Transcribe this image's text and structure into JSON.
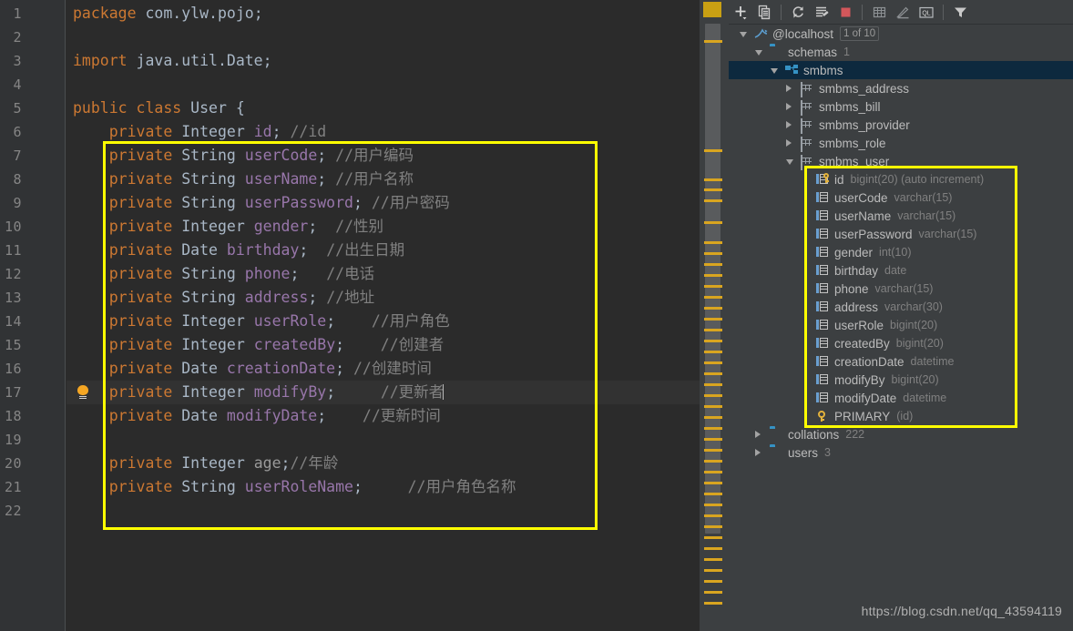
{
  "editor": {
    "line_numbers": [
      "1",
      "2",
      "3",
      "4",
      "5",
      "6",
      "7",
      "8",
      "9",
      "10",
      "11",
      "12",
      "13",
      "14",
      "15",
      "16",
      "17",
      "18",
      "19",
      "20",
      "21",
      "22"
    ],
    "current_line": "17",
    "intention_bulb_icon": "lightbulb-icon",
    "lines": [
      {
        "n": "1",
        "segments": [
          {
            "t": "package ",
            "c": "kw"
          },
          {
            "t": "com.ylw.pojo;",
            "c": "pkg"
          }
        ]
      },
      {
        "n": "2",
        "segments": []
      },
      {
        "n": "3",
        "segments": [
          {
            "t": "import ",
            "c": "kw"
          },
          {
            "t": "java.util.Date;",
            "c": "pkg"
          }
        ]
      },
      {
        "n": "4",
        "segments": []
      },
      {
        "n": "5",
        "segments": [
          {
            "t": "public class ",
            "c": "kw"
          },
          {
            "t": "User",
            "c": "cname"
          },
          {
            "t": " {",
            "c": "pun"
          }
        ]
      },
      {
        "n": "6",
        "segments": [
          {
            "t": "    ",
            "c": "pun"
          },
          {
            "t": "private ",
            "c": "kw"
          },
          {
            "t": "Integer ",
            "c": "typ"
          },
          {
            "t": "id",
            "c": "fld"
          },
          {
            "t": "; ",
            "c": "pun"
          },
          {
            "t": "//id",
            "c": "cmt"
          }
        ]
      },
      {
        "n": "7",
        "segments": [
          {
            "t": "    ",
            "c": "pun"
          },
          {
            "t": "private ",
            "c": "kw"
          },
          {
            "t": "String ",
            "c": "typ"
          },
          {
            "t": "userCode",
            "c": "fld"
          },
          {
            "t": "; ",
            "c": "pun"
          },
          {
            "t": "//用户编码",
            "c": "cmt"
          }
        ]
      },
      {
        "n": "8",
        "segments": [
          {
            "t": "    ",
            "c": "pun"
          },
          {
            "t": "private ",
            "c": "kw"
          },
          {
            "t": "String ",
            "c": "typ"
          },
          {
            "t": "userName",
            "c": "fld"
          },
          {
            "t": "; ",
            "c": "pun"
          },
          {
            "t": "//用户名称",
            "c": "cmt"
          }
        ]
      },
      {
        "n": "9",
        "segments": [
          {
            "t": "    ",
            "c": "pun"
          },
          {
            "t": "private ",
            "c": "kw"
          },
          {
            "t": "String ",
            "c": "typ"
          },
          {
            "t": "userPassword",
            "c": "fld"
          },
          {
            "t": "; ",
            "c": "pun"
          },
          {
            "t": "//用户密码",
            "c": "cmt"
          }
        ]
      },
      {
        "n": "10",
        "segments": [
          {
            "t": "    ",
            "c": "pun"
          },
          {
            "t": "private ",
            "c": "kw"
          },
          {
            "t": "Integer ",
            "c": "typ"
          },
          {
            "t": "gender",
            "c": "fld"
          },
          {
            "t": ";  ",
            "c": "pun"
          },
          {
            "t": "//性别",
            "c": "cmt"
          }
        ]
      },
      {
        "n": "11",
        "segments": [
          {
            "t": "    ",
            "c": "pun"
          },
          {
            "t": "private ",
            "c": "kw"
          },
          {
            "t": "Date ",
            "c": "typ"
          },
          {
            "t": "birthday",
            "c": "fld"
          },
          {
            "t": ";  ",
            "c": "pun"
          },
          {
            "t": "//出生日期",
            "c": "cmt"
          }
        ]
      },
      {
        "n": "12",
        "segments": [
          {
            "t": "    ",
            "c": "pun"
          },
          {
            "t": "private ",
            "c": "kw"
          },
          {
            "t": "String ",
            "c": "typ"
          },
          {
            "t": "phone",
            "c": "fld"
          },
          {
            "t": ";   ",
            "c": "pun"
          },
          {
            "t": "//电话",
            "c": "cmt"
          }
        ]
      },
      {
        "n": "13",
        "segments": [
          {
            "t": "    ",
            "c": "pun"
          },
          {
            "t": "private ",
            "c": "kw"
          },
          {
            "t": "String ",
            "c": "typ"
          },
          {
            "t": "address",
            "c": "fld"
          },
          {
            "t": "; ",
            "c": "pun"
          },
          {
            "t": "//地址",
            "c": "cmt"
          }
        ]
      },
      {
        "n": "14",
        "segments": [
          {
            "t": "    ",
            "c": "pun"
          },
          {
            "t": "private ",
            "c": "kw"
          },
          {
            "t": "Integer ",
            "c": "typ"
          },
          {
            "t": "userRole",
            "c": "fld"
          },
          {
            "t": ";    ",
            "c": "pun"
          },
          {
            "t": "//用户角色",
            "c": "cmt"
          }
        ]
      },
      {
        "n": "15",
        "segments": [
          {
            "t": "    ",
            "c": "pun"
          },
          {
            "t": "private ",
            "c": "kw"
          },
          {
            "t": "Integer ",
            "c": "typ"
          },
          {
            "t": "createdBy",
            "c": "fld"
          },
          {
            "t": ";    ",
            "c": "pun"
          },
          {
            "t": "//创建者",
            "c": "cmt"
          }
        ]
      },
      {
        "n": "16",
        "segments": [
          {
            "t": "    ",
            "c": "pun"
          },
          {
            "t": "private ",
            "c": "kw"
          },
          {
            "t": "Date ",
            "c": "typ"
          },
          {
            "t": "creationDate",
            "c": "fld"
          },
          {
            "t": "; ",
            "c": "pun"
          },
          {
            "t": "//创建时间",
            "c": "cmt"
          }
        ]
      },
      {
        "n": "17",
        "segments": [
          {
            "t": "    ",
            "c": "pun"
          },
          {
            "t": "private ",
            "c": "kw"
          },
          {
            "t": "Integer ",
            "c": "typ"
          },
          {
            "t": "modifyBy",
            "c": "fld"
          },
          {
            "t": ";     ",
            "c": "pun"
          },
          {
            "t": "//更新者",
            "c": "cmt"
          }
        ],
        "caret": true
      },
      {
        "n": "18",
        "segments": [
          {
            "t": "    ",
            "c": "pun"
          },
          {
            "t": "private ",
            "c": "kw"
          },
          {
            "t": "Date ",
            "c": "typ"
          },
          {
            "t": "modifyDate",
            "c": "fld"
          },
          {
            "t": ";    ",
            "c": "pun"
          },
          {
            "t": "//更新时间",
            "c": "cmt"
          }
        ]
      },
      {
        "n": "19",
        "segments": []
      },
      {
        "n": "20",
        "segments": [
          {
            "t": "    ",
            "c": "pun"
          },
          {
            "t": "private ",
            "c": "kw"
          },
          {
            "t": "Integer ",
            "c": "typ"
          },
          {
            "t": "age",
            "c": "fldg"
          },
          {
            "t": ";",
            "c": "pun"
          },
          {
            "t": "//年龄",
            "c": "cmt"
          }
        ]
      },
      {
        "n": "21",
        "segments": [
          {
            "t": "    ",
            "c": "pun"
          },
          {
            "t": "private ",
            "c": "kw"
          },
          {
            "t": "String ",
            "c": "typ"
          },
          {
            "t": "userRoleName",
            "c": "fld"
          },
          {
            "t": ";     ",
            "c": "pun"
          },
          {
            "t": "//用户角色名称",
            "c": "cmt"
          }
        ]
      },
      {
        "n": "22",
        "segments": []
      }
    ]
  },
  "annotations": {
    "code_box_color": "#ffff00",
    "tree_box_color": "#ffff00"
  },
  "scrollbar": {
    "warning_marker_color": "#d9a520",
    "top_marker_color": "#c9a013",
    "thumb_color": "#595b5d"
  },
  "db_panel": {
    "toolbar": [
      {
        "name": "add-icon",
        "label": "+"
      },
      {
        "name": "duplicate-icon",
        "label": "duplicate"
      },
      {
        "name": "refresh-icon",
        "label": "refresh"
      },
      {
        "name": "sql-script-icon",
        "label": "jump-to-query"
      },
      {
        "name": "stop-icon",
        "label": "stop"
      },
      {
        "name": "data-table-icon",
        "label": "open-data-editor"
      },
      {
        "name": "edit-icon",
        "label": "modify"
      },
      {
        "name": "query-console-icon",
        "label": "QL"
      },
      {
        "name": "filter-icon",
        "label": "filter"
      }
    ],
    "tree": [
      {
        "indent": 0,
        "twisty": "down",
        "icon": "mysql-connection-icon",
        "label": "@localhost",
        "badge": "1 of 10",
        "meta": "",
        "selected": false
      },
      {
        "indent": 1,
        "twisty": "down",
        "icon": "folder-icon",
        "label": "schemas",
        "badge": "",
        "meta": "1",
        "selected": false
      },
      {
        "indent": 2,
        "twisty": "down",
        "icon": "schema-icon",
        "label": "smbms",
        "badge": "",
        "meta": "",
        "selected": true
      },
      {
        "indent": 3,
        "twisty": "right",
        "icon": "table-icon",
        "label": "smbms_address",
        "badge": "",
        "meta": "",
        "selected": false
      },
      {
        "indent": 3,
        "twisty": "right",
        "icon": "table-icon",
        "label": "smbms_bill",
        "badge": "",
        "meta": "",
        "selected": false
      },
      {
        "indent": 3,
        "twisty": "right",
        "icon": "table-icon",
        "label": "smbms_provider",
        "badge": "",
        "meta": "",
        "selected": false
      },
      {
        "indent": 3,
        "twisty": "right",
        "icon": "table-icon",
        "label": "smbms_role",
        "badge": "",
        "meta": "",
        "selected": false
      },
      {
        "indent": 3,
        "twisty": "down",
        "icon": "table-icon",
        "label": "smbms_user",
        "badge": "",
        "meta": "",
        "selected": false
      },
      {
        "indent": 4,
        "twisty": "none",
        "icon": "primary-column-icon",
        "label": "id",
        "badge": "",
        "meta": "bigint(20) (auto increment)",
        "selected": false
      },
      {
        "indent": 4,
        "twisty": "none",
        "icon": "column-icon",
        "label": "userCode",
        "badge": "",
        "meta": "varchar(15)",
        "selected": false
      },
      {
        "indent": 4,
        "twisty": "none",
        "icon": "column-icon",
        "label": "userName",
        "badge": "",
        "meta": "varchar(15)",
        "selected": false
      },
      {
        "indent": 4,
        "twisty": "none",
        "icon": "column-icon",
        "label": "userPassword",
        "badge": "",
        "meta": "varchar(15)",
        "selected": false
      },
      {
        "indent": 4,
        "twisty": "none",
        "icon": "column-icon",
        "label": "gender",
        "badge": "",
        "meta": "int(10)",
        "selected": false
      },
      {
        "indent": 4,
        "twisty": "none",
        "icon": "column-icon",
        "label": "birthday",
        "badge": "",
        "meta": "date",
        "selected": false
      },
      {
        "indent": 4,
        "twisty": "none",
        "icon": "column-icon",
        "label": "phone",
        "badge": "",
        "meta": "varchar(15)",
        "selected": false
      },
      {
        "indent": 4,
        "twisty": "none",
        "icon": "column-icon",
        "label": "address",
        "badge": "",
        "meta": "varchar(30)",
        "selected": false
      },
      {
        "indent": 4,
        "twisty": "none",
        "icon": "column-icon",
        "label": "userRole",
        "badge": "",
        "meta": "bigint(20)",
        "selected": false
      },
      {
        "indent": 4,
        "twisty": "none",
        "icon": "column-icon",
        "label": "createdBy",
        "badge": "",
        "meta": "bigint(20)",
        "selected": false
      },
      {
        "indent": 4,
        "twisty": "none",
        "icon": "column-icon",
        "label": "creationDate",
        "badge": "",
        "meta": "datetime",
        "selected": false
      },
      {
        "indent": 4,
        "twisty": "none",
        "icon": "column-icon",
        "label": "modifyBy",
        "badge": "",
        "meta": "bigint(20)",
        "selected": false
      },
      {
        "indent": 4,
        "twisty": "none",
        "icon": "column-icon",
        "label": "modifyDate",
        "badge": "",
        "meta": "datetime",
        "selected": false
      },
      {
        "indent": 4,
        "twisty": "none",
        "icon": "key-icon",
        "label": "PRIMARY",
        "badge": "",
        "meta": "(id)",
        "selected": false
      },
      {
        "indent": 1,
        "twisty": "right",
        "icon": "folder-icon",
        "label": "collations",
        "badge": "",
        "meta": "222",
        "selected": false
      },
      {
        "indent": 1,
        "twisty": "right",
        "icon": "folder-icon",
        "label": "users",
        "badge": "",
        "meta": "3",
        "selected": false
      }
    ]
  },
  "watermark": {
    "text": "https://blog.csdn.net/qq_43594119"
  }
}
